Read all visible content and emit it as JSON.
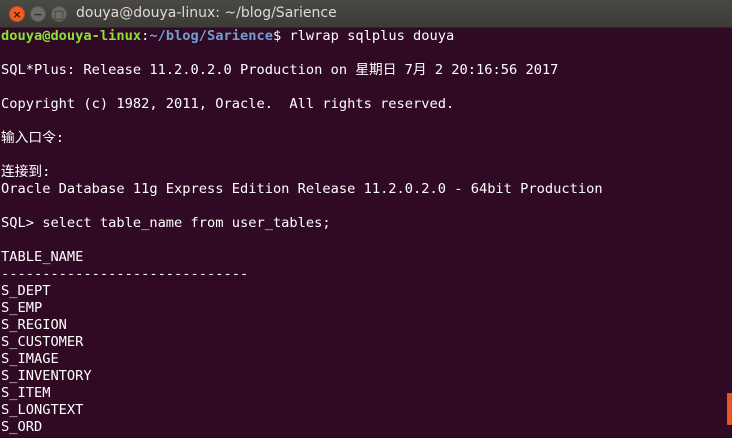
{
  "window": {
    "title": "douya@douya-linux: ~/blog/Sarience",
    "close_glyph": "×",
    "minimize_glyph": "−",
    "maximize_glyph": "□"
  },
  "prompt": {
    "user_host": "douya@douya-linux",
    "separator": ":",
    "path": "~/blog/Sarience",
    "symbol": "$ ",
    "command": "rlwrap sqlplus douya"
  },
  "output": {
    "release": "SQL*Plus: Release 11.2.0.2.0 Production on 星期日 7月 2 20:16:56 2017",
    "copyright": "Copyright (c) 1982, 2011, Oracle.  All rights reserved.",
    "password_prompt": "输入口令:",
    "connected_to": "连接到:",
    "db_version": "Oracle Database 11g Express Edition Release 11.2.0.2.0 - 64bit Production",
    "sql_query": "SQL> select table_name from user_tables;",
    "column_header": "TABLE_NAME",
    "column_rule": "------------------------------",
    "tables": [
      "S_DEPT",
      "S_EMP",
      "S_REGION",
      "S_CUSTOMER",
      "S_IMAGE",
      "S_INVENTORY",
      "S_ITEM",
      "S_LONGTEXT",
      "S_ORD"
    ]
  },
  "colors": {
    "background": "#300a24",
    "prompt_user": "#8ae234",
    "prompt_path": "#729fcf",
    "scrollbar": "#e95420"
  }
}
